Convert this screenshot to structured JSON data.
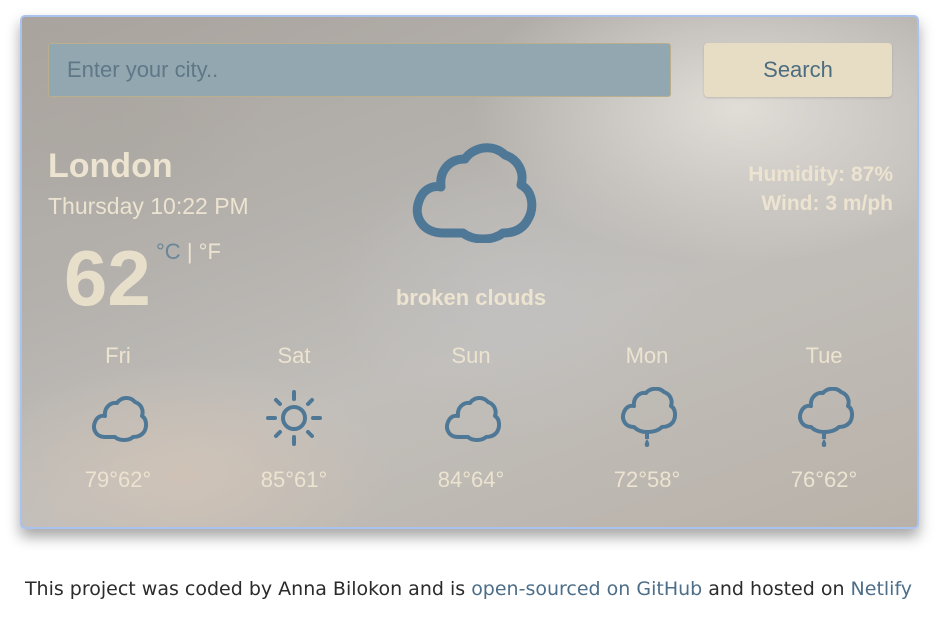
{
  "search": {
    "placeholder": "Enter your city..",
    "button_label": "Search"
  },
  "current": {
    "city": "London",
    "date_time": "Thursday 10:22 PM",
    "temperature": "62",
    "unit_celsius": "°C",
    "unit_separator": "|",
    "unit_fahrenheit": "°F",
    "icon": "cloud-icon",
    "description": "broken clouds",
    "humidity": "Humidity: 87%",
    "wind": "Wind: 3 m/ph"
  },
  "forecast": [
    {
      "day": "Fri",
      "icon": "cloud-icon",
      "temps": "79°62°"
    },
    {
      "day": "Sat",
      "icon": "sun-icon",
      "temps": "85°61°"
    },
    {
      "day": "Sun",
      "icon": "cloud-icon",
      "temps": "84°64°"
    },
    {
      "day": "Mon",
      "icon": "rain-cloud-icon",
      "temps": "72°58°"
    },
    {
      "day": "Tue",
      "icon": "rain-cloud-icon",
      "temps": "76°62°"
    }
  ],
  "footer": {
    "text_1": "This project was coded by Anna Bilokon and is ",
    "link_github": "open-sourced on GitHub",
    "text_2": " and hosted on ",
    "link_netlify": "Netlify"
  },
  "colors": {
    "icon_blue": "#4f7896",
    "text_cream": "#ece3d0",
    "button_bg": "#e7dcc4",
    "input_bg": "#93a7b0",
    "card_border": "#a9c2ee"
  }
}
